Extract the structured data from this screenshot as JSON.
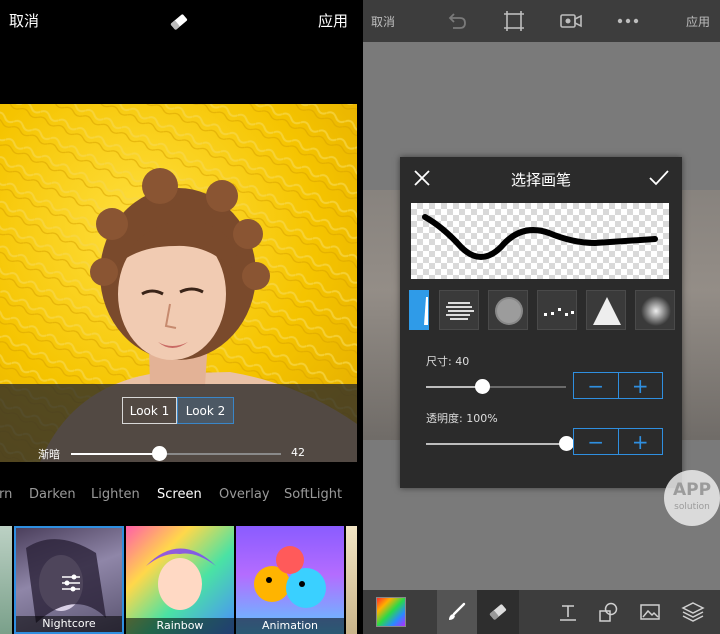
{
  "left": {
    "toolbar": {
      "cancel": "取消",
      "apply": "应用",
      "eraser_icon": "eraser-icon"
    },
    "looks": [
      {
        "label": "Look 1"
      },
      {
        "label": "Look 2"
      }
    ],
    "fade": {
      "label": "渐暗",
      "value": 42,
      "max": 100
    },
    "blend_modes": [
      "rn",
      "Darken",
      "Lighten",
      "Screen",
      "Overlay",
      "SoftLight"
    ],
    "active_blend": "Screen",
    "thumbnails": [
      {
        "label": "Nightcore"
      },
      {
        "label": "Rainbow"
      },
      {
        "label": "Animation"
      }
    ]
  },
  "right": {
    "toolbar": {
      "cancel": "取消",
      "apply": "应用"
    },
    "dialog": {
      "title": "选择画笔",
      "size": {
        "label": "尺寸: 40",
        "value": 40,
        "max": 100
      },
      "opacity": {
        "label": "透明度: 100%",
        "value": 100,
        "max": 100
      },
      "minus": "−",
      "plus": "+"
    },
    "watermark": {
      "line1": "APP",
      "line2": "solution"
    }
  },
  "colors": {
    "accent": "#2f8fe0",
    "photo_bg": "#f5c400",
    "dialog_bg": "#2b2b2b"
  }
}
